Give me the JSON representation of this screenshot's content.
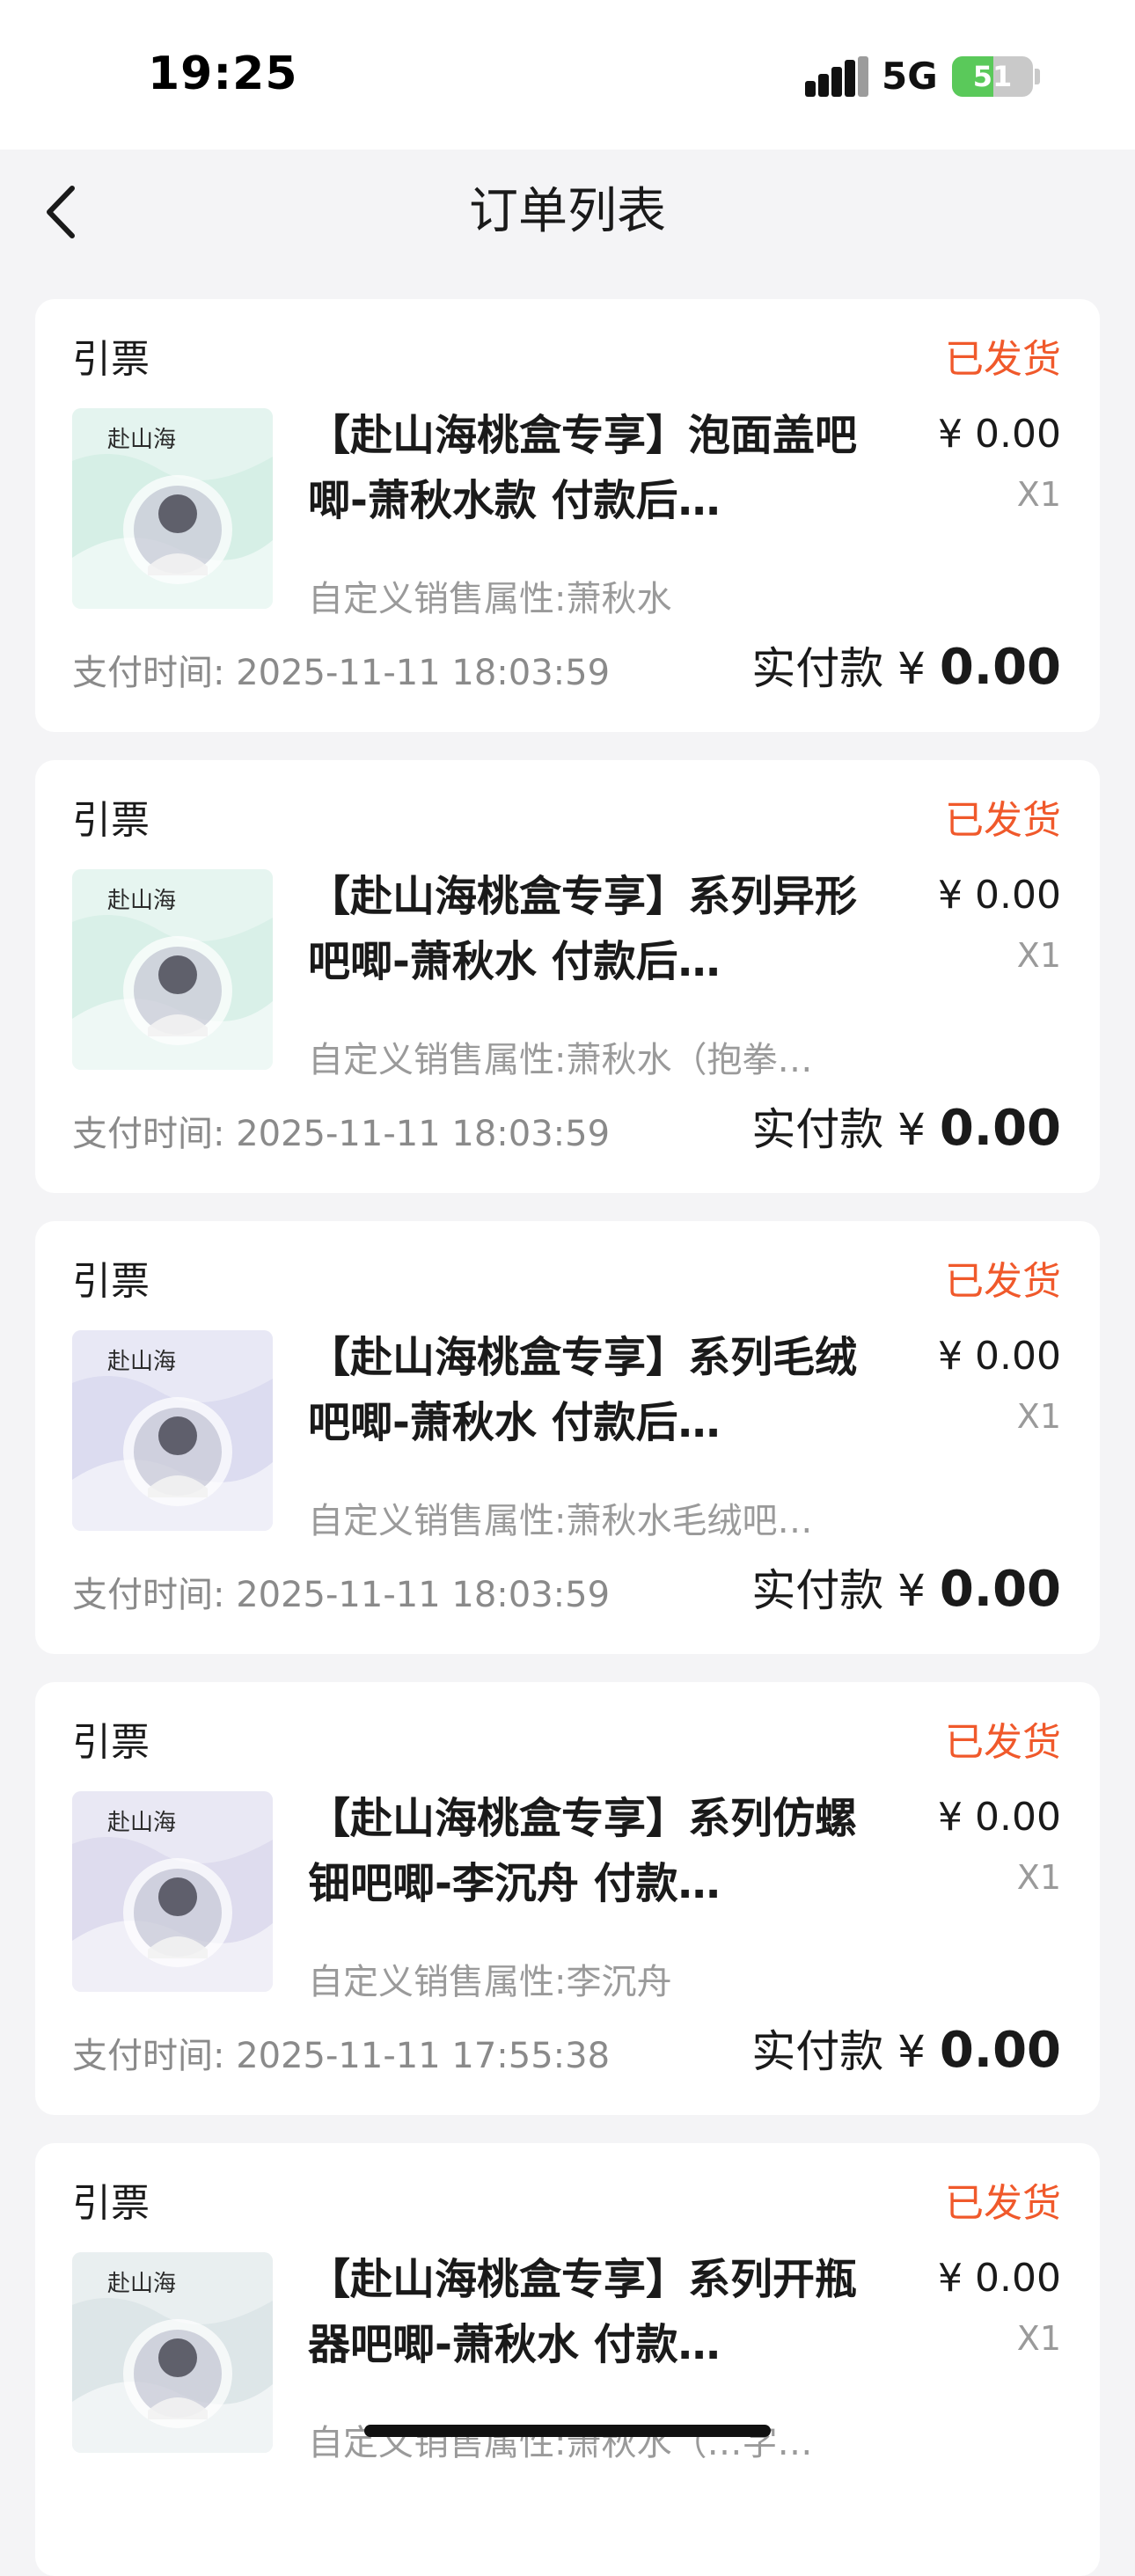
{
  "status_bar": {
    "time": "19:25",
    "network": "5G",
    "battery": "51",
    "battery_level": 0.51
  },
  "nav": {
    "title": "订单列表"
  },
  "orders": [
    {
      "merchant": "引票",
      "status": "已发货",
      "product": "【赴山海桃盒专享】泡面盖吧唧-萧秋水款 付款后…",
      "price": "¥ 0.00",
      "qty": "X1",
      "attr": "自定义销售属性:萧秋水",
      "pay_time": "支付时间: 2025-11-11 18:03:59",
      "paid_label": "实付款 ¥ ",
      "paid_amount": "0.00",
      "thumb_title": "赴山海",
      "thumb_bg": "#d6efe6"
    },
    {
      "merchant": "引票",
      "status": "已发货",
      "product": "【赴山海桃盒专享】系列异形吧唧-萧秋水 付款后…",
      "price": "¥ 0.00",
      "qty": "X1",
      "attr": "自定义销售属性:萧秋水（抱拳…",
      "pay_time": "支付时间: 2025-11-11 18:03:59",
      "paid_label": "实付款 ¥ ",
      "paid_amount": "0.00",
      "thumb_title": "赴山海",
      "thumb_bg": "#d9f0e8"
    },
    {
      "merchant": "引票",
      "status": "已发货",
      "product": "【赴山海桃盒专享】系列毛绒吧唧-萧秋水 付款后…",
      "price": "¥ 0.00",
      "qty": "X1",
      "attr": "自定义销售属性:萧秋水毛绒吧…",
      "pay_time": "支付时间: 2025-11-11 18:03:59",
      "paid_label": "实付款 ¥ ",
      "paid_amount": "0.00",
      "thumb_title": "赴山海",
      "thumb_bg": "#dcdcf0"
    },
    {
      "merchant": "引票",
      "status": "已发货",
      "product": "【赴山海桃盒专享】系列仿螺钿吧唧-李沉舟 付款…",
      "price": "¥ 0.00",
      "qty": "X1",
      "attr": "自定义销售属性:李沉舟",
      "pay_time": "支付时间: 2025-11-11 17:55:38",
      "paid_label": "实付款 ¥ ",
      "paid_amount": "0.00",
      "thumb_title": "赴山海",
      "thumb_bg": "#dedcee"
    },
    {
      "merchant": "引票",
      "status": "已发货",
      "product": "【赴山海桃盒专享】系列开瓶器吧唧-萧秋水 付款…",
      "price": "¥ 0.00",
      "qty": "X1",
      "attr": "自定义销售属性:萧秋水（…字…",
      "pay_time": "",
      "paid_label": "",
      "paid_amount": "",
      "thumb_title": "赴山海",
      "thumb_bg": "#dde6e8"
    }
  ],
  "colors": {
    "status": "#f0592b",
    "background": "#f4f4f6"
  }
}
